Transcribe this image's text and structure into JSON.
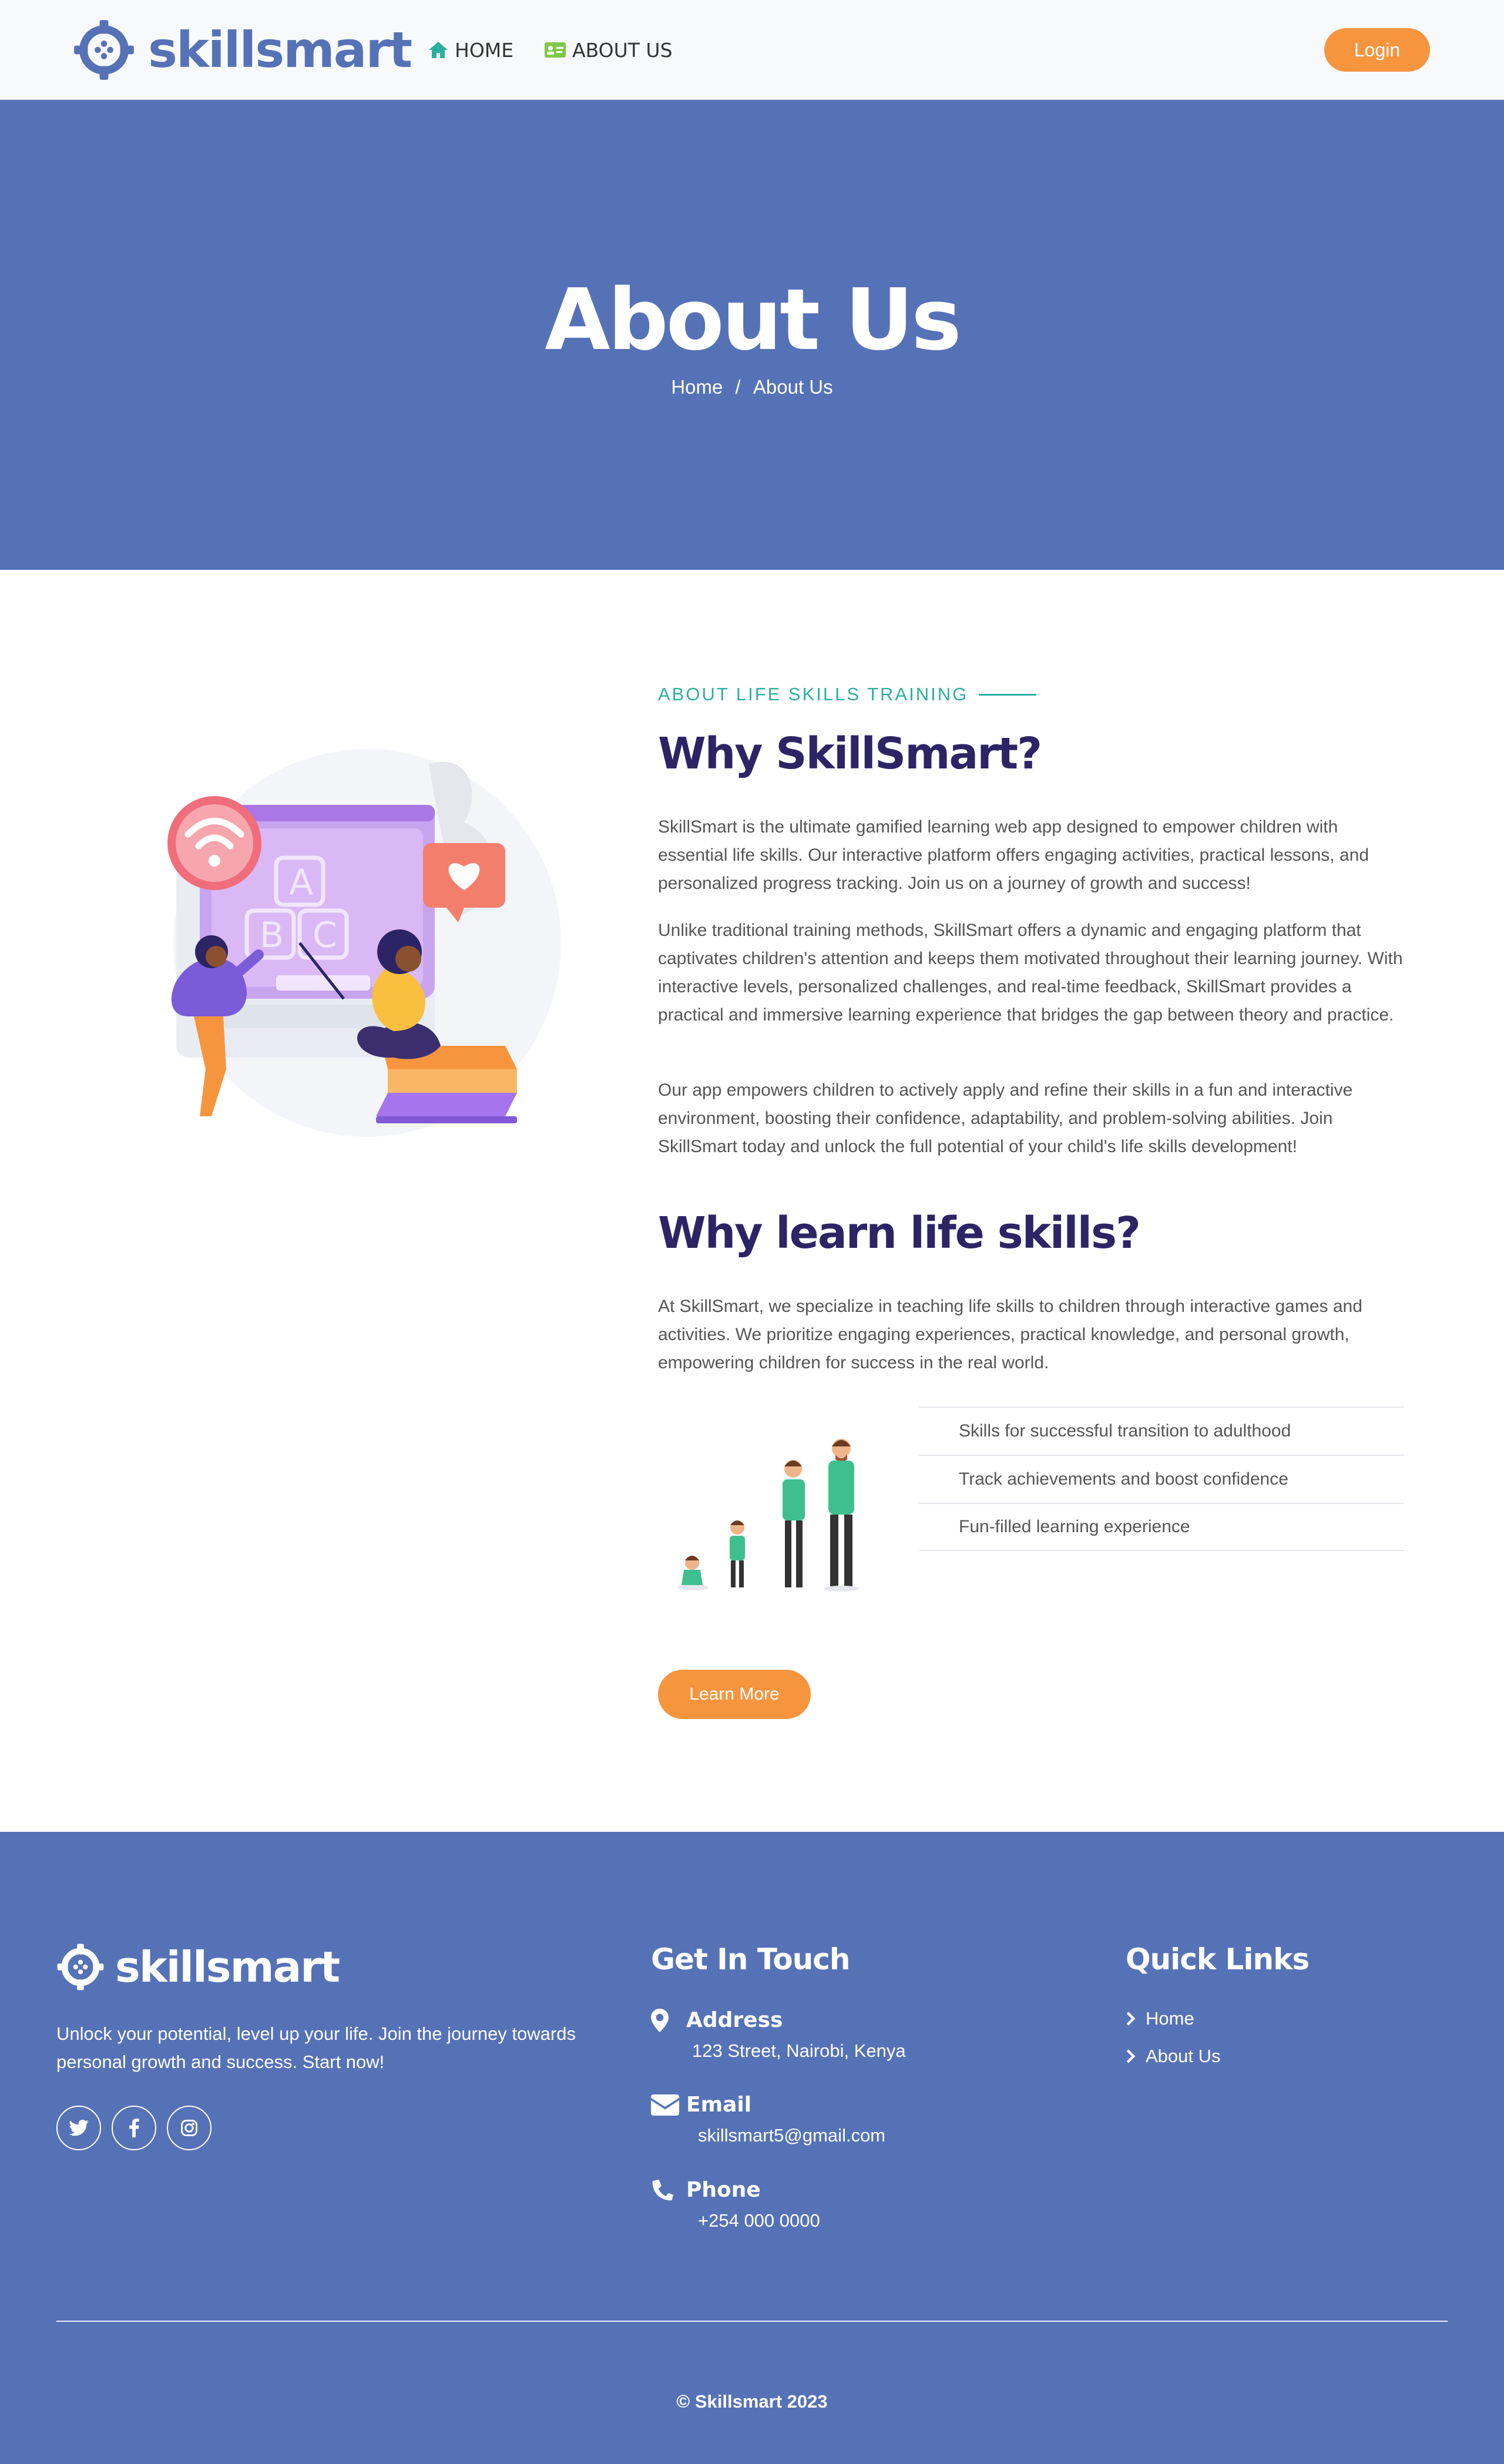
{
  "brand": {
    "name": "skillsmart",
    "accent": "#5672b7",
    "orange": "#f7953f",
    "teal": "#2ab0a0",
    "heading_color": "#2d2466"
  },
  "nav": {
    "home_label": "HOME",
    "about_label": "ABOUT US",
    "home_icon": "home-icon",
    "about_icon": "id-card-icon",
    "login_label": "Login"
  },
  "hero": {
    "title": "About Us",
    "breadcrumb": [
      "Home",
      "/",
      "About Us"
    ]
  },
  "about": {
    "kicker": "ABOUT LIFE SKILLS TRAINING",
    "heading": "Why SkillSmart?",
    "paragraphs": [
      "SkillSmart is the ultimate gamified learning web app designed to empower children with essential life skills. Our interactive platform offers engaging activities, practical lessons, and personalized progress tracking. Join us on a journey of growth and success!",
      "Unlike traditional training methods, SkillSmart offers a dynamic and engaging platform that captivates children's attention and keeps them motivated throughout their learning journey. With interactive levels, personalized challenges, and real-time feedback, SkillSmart provides a practical and immersive learning experience that bridges the gap between theory and practice.",
      "Our app empowers children to actively apply and refine their skills in a fun and interactive environment, boosting their confidence, adaptability, and problem-solving abilities. Join SkillSmart today and unlock the full potential of your child's life skills development!"
    ],
    "heading2": "Why learn life skills?",
    "paragraph2": "At SkillSmart, we specialize in teaching life skills to children through interactive games and activities. We prioritize engaging experiences, practical knowledge, and personal growth, empowering children for success in the real world.",
    "features": [
      "Skills for successful transition to adulthood",
      "Track achievements and boost confidence",
      "Fun-filled learning experience"
    ],
    "cta_label": "Learn More"
  },
  "footer": {
    "brand": "skillsmart",
    "description": "Unlock your potential, level up your life. Join the journey towards personal growth and success. Start now!",
    "social_icons": [
      "twitter-icon",
      "facebook-icon",
      "instagram-icon"
    ],
    "touch_heading": "Get In Touch",
    "address_label": "Address",
    "address_value": "123 Street, Nairobi, Kenya",
    "email_label": "Email",
    "email_value": "skillsmart5@gmail.com",
    "phone_label": "Phone",
    "phone_value": "+254 000 0000",
    "links_heading": "Quick Links",
    "links": [
      "Home",
      "About Us"
    ],
    "copyright": "© Skillsmart 2023"
  }
}
